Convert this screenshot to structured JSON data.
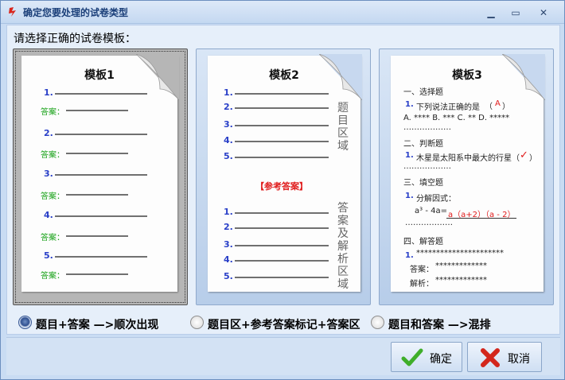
{
  "window": {
    "title": "确定您要处理的试卷类型",
    "minimize_glyph": "▁",
    "maximize_glyph": "▭",
    "close_glyph": "✕"
  },
  "prompt": "请选择正确的试卷模板：",
  "templates": [
    {
      "title": "模板1",
      "numbers": [
        "1.",
        "2.",
        "3.",
        "4.",
        "5."
      ],
      "answer_label": "答案："
    },
    {
      "title": "模板2",
      "numbers": [
        "1.",
        "2.",
        "3.",
        "4.",
        "5."
      ],
      "question_area_label": "题目区域",
      "reference_marker": "【参考答案】",
      "answer_area_label": "答案及解析区域"
    },
    {
      "title": "模板3",
      "sec1": "一、选择题",
      "q1_num": "1.",
      "q1_text": "下列说法正确的是",
      "q1_paren_open": "（",
      "q1_answer": "A",
      "q1_paren_close": "）",
      "q1_options": "A. ****  B. ***   C. **   D. *****",
      "q1_dots": "………………",
      "sec2": "二、判断题",
      "q2_num": "1.",
      "q2_text": "木星是太阳系中最大的行星（",
      "q2_check": "✓",
      "q2_paren_close": "）",
      "q2_dots": "………………",
      "sec3": "三、填空题",
      "q3_num": "1.",
      "q3_text": "分解因式：",
      "q3_formula": "a³ - 4a=",
      "q3_answer": "a（a+2）（a - 2）",
      "q3_dots": "………………",
      "sec4": "四、解答题",
      "q4_num": "1.",
      "q4_stars": "**********************",
      "q4_answer_label": "答案：",
      "q4_answer_stars": "*************",
      "q4_analysis_label": "解析：",
      "q4_analysis_stars": "*************"
    }
  ],
  "options": [
    {
      "label": "题目+答案 —>顺次出现",
      "checked": true
    },
    {
      "label": "题目区+参考答案标记+答案区",
      "checked": false
    },
    {
      "label": "题目和答案 —>混排",
      "checked": false
    }
  ],
  "buttons": {
    "ok": "确定",
    "cancel": "取消"
  },
  "colors": {
    "number_blue": "#2a40c8",
    "answer_green": "#14a014",
    "mark_red": "#e01a1a",
    "title_blue": "#1b3f79"
  }
}
